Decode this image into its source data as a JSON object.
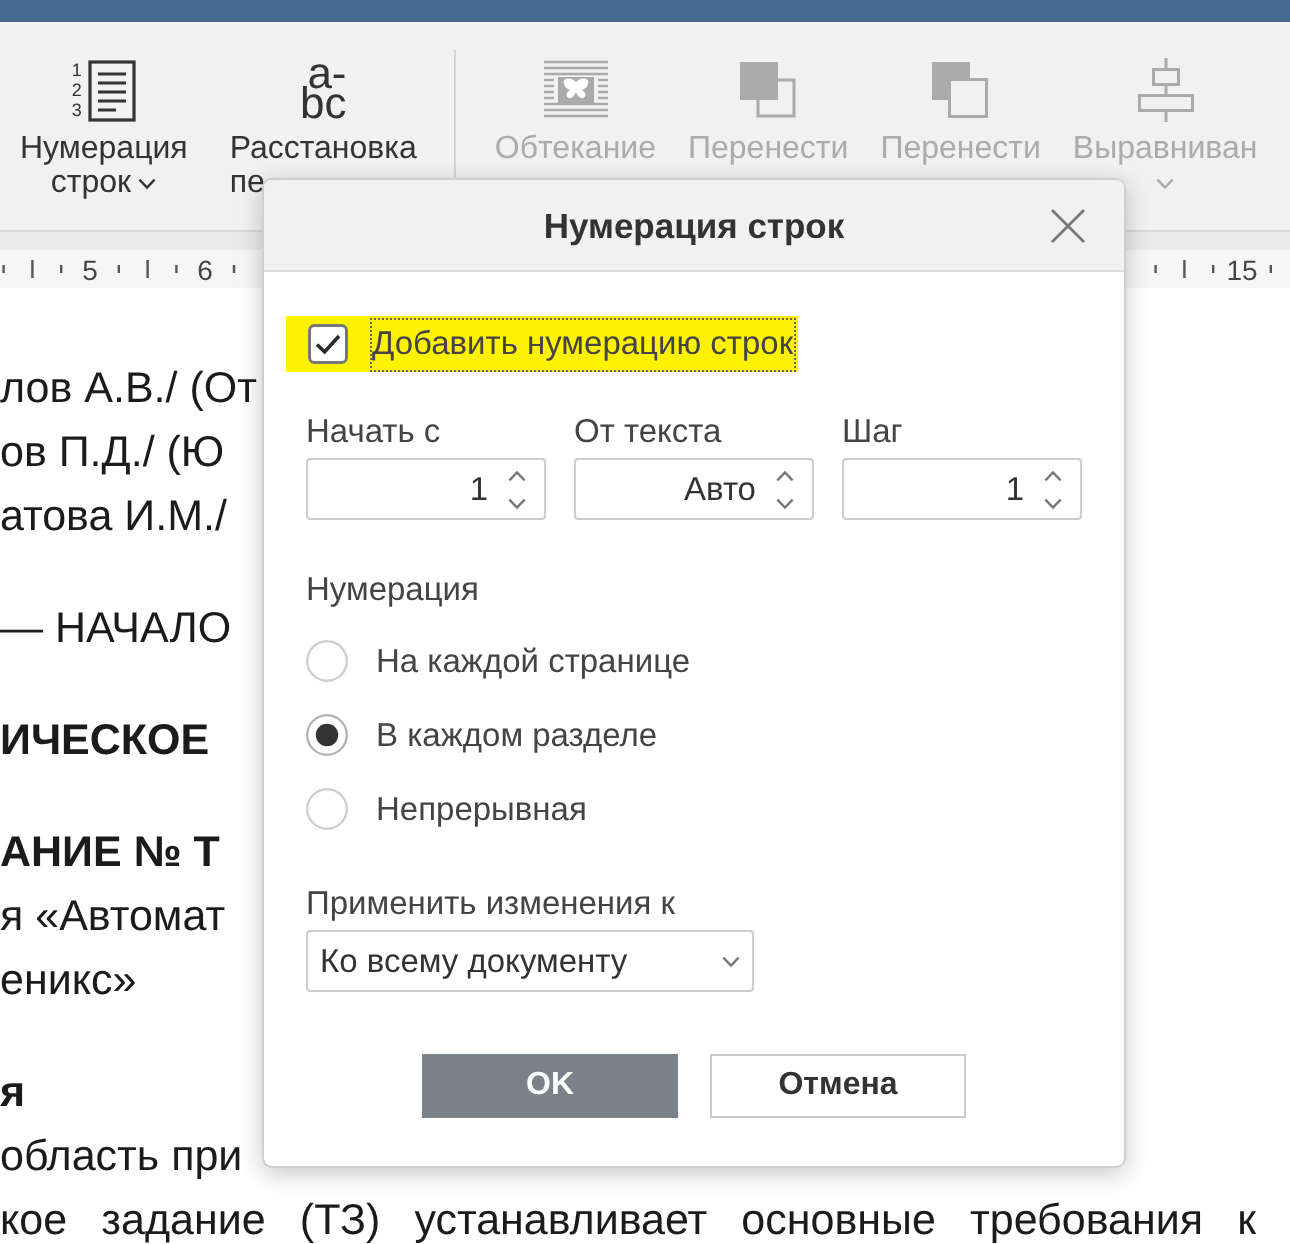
{
  "toolbar": {
    "groups": [
      {
        "items": [
          {
            "kind": "line-numbers",
            "icon_text": [
              "1",
              "2",
              "3"
            ],
            "label_lines": [
              "Нумерация",
              "строк"
            ],
            "dropdown": true,
            "disabled": false
          },
          {
            "kind": "hyphenation",
            "icon_text": [
              "a-",
              "bc"
            ],
            "label_lines": [
              "Расстановка",
              "пе"
            ],
            "dropdown": false,
            "disabled": false
          }
        ]
      },
      {
        "items": [
          {
            "kind": "wrap",
            "label_lines": [
              "Обтекание"
            ],
            "dropdown": false,
            "disabled": true
          },
          {
            "kind": "bring-forward",
            "label_lines": [
              "Перенести"
            ],
            "dropdown": false,
            "disabled": true
          },
          {
            "kind": "send-backward",
            "label_lines": [
              "Перенести"
            ],
            "dropdown": false,
            "disabled": true
          },
          {
            "kind": "align",
            "label_lines": [
              "Выравниван"
            ],
            "dropdown": true,
            "disabled": true
          }
        ]
      }
    ]
  },
  "ruler": {
    "left_labels": [
      "5",
      "6"
    ],
    "right_labels": [
      "15"
    ]
  },
  "document": {
    "paragraphs": [
      {
        "lines": [
          {
            "kind": "body",
            "text": "лов А.В./ (От"
          },
          {
            "kind": "body",
            "text": "ов П.Д./ (Ю"
          },
          {
            "kind": "body",
            "text": "атова И.М./"
          }
        ]
      },
      {
        "lines": [
          {
            "kind": "body",
            "text": "— НАЧАЛО"
          }
        ]
      },
      {
        "lines": [
          {
            "kind": "heading",
            "text": "ИЧЕСКОЕ"
          }
        ]
      },
      {
        "lines": [
          {
            "kind": "heading",
            "text": "АНИЕ № Т"
          },
          {
            "kind": "body",
            "text": "я «Автомат"
          },
          {
            "kind": "body",
            "text": "еникс»"
          }
        ]
      },
      {
        "lines": [
          {
            "kind": "heading",
            "text": "я"
          },
          {
            "kind": "body",
            "text": "область при"
          },
          {
            "kind": "justified",
            "text": "кое задание (ТЗ) устанавливает основные требования к"
          }
        ]
      }
    ]
  },
  "dialog": {
    "title": "Нумерация строк",
    "add_numbering": {
      "label": "Добавить нумерацию строк",
      "checked": true,
      "highlighted": true,
      "focused": true
    },
    "fields": [
      {
        "label": "Начать с",
        "value": "1"
      },
      {
        "label": "От текста",
        "value": "Авто"
      },
      {
        "label": "Шаг",
        "value": "1"
      }
    ],
    "numbering": {
      "label": "Нумерация",
      "options": [
        {
          "label": "На каждой странице",
          "selected": false
        },
        {
          "label": "В каждом разделе",
          "selected": true
        },
        {
          "label": "Непрерывная",
          "selected": false
        }
      ]
    },
    "apply_to": {
      "label": "Применить изменения к",
      "value": "Ко всему документу"
    },
    "buttons": [
      {
        "kind": "primary",
        "label": "OK"
      },
      {
        "kind": "secondary",
        "label": "Отмена"
      }
    ]
  }
}
